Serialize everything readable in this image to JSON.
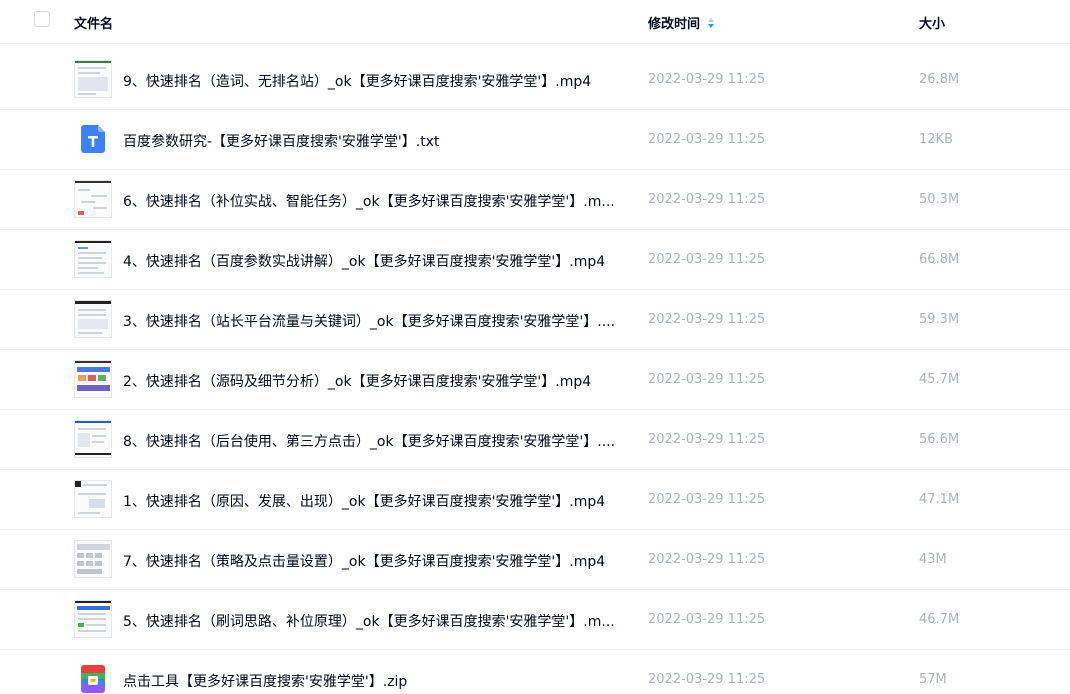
{
  "header": {
    "name_label": "文件名",
    "time_label": "修改时间",
    "size_label": "大小"
  },
  "files": [
    {
      "name": "9、快速排名（造词、无排名站）_ok【更多好课百度搜索'安雅学堂'】.mp4",
      "time": "2022-03-29 11:25",
      "size": "26.8M",
      "type": "video"
    },
    {
      "name": "百度参数研究-【更多好课百度搜索'安雅学堂'】.txt",
      "time": "2022-03-29 11:25",
      "size": "12KB",
      "type": "text"
    },
    {
      "name": "6、快速排名（补位实战、智能任务）_ok【更多好课百度搜索'安雅学堂'】.m...",
      "time": "2022-03-29 11:25",
      "size": "50.3M",
      "type": "video"
    },
    {
      "name": "4、快速排名（百度参数实战讲解）_ok【更多好课百度搜索'安雅学堂'】.mp4",
      "time": "2022-03-29 11:25",
      "size": "66.8M",
      "type": "video"
    },
    {
      "name": "3、快速排名（站长平台流量与关键词）_ok【更多好课百度搜索'安雅学堂'】....",
      "time": "2022-03-29 11:25",
      "size": "59.3M",
      "type": "video"
    },
    {
      "name": "2、快速排名（源码及细节分析）_ok【更多好课百度搜索'安雅学堂'】.mp4",
      "time": "2022-03-29 11:25",
      "size": "45.7M",
      "type": "video"
    },
    {
      "name": "8、快速排名（后台使用、第三方点击）_ok【更多好课百度搜索'安雅学堂'】....",
      "time": "2022-03-29 11:25",
      "size": "56.6M",
      "type": "video"
    },
    {
      "name": "1、快速排名（原因、发展、出现）_ok【更多好课百度搜索'安雅学堂'】.mp4",
      "time": "2022-03-29 11:25",
      "size": "47.1M",
      "type": "video"
    },
    {
      "name": "7、快速排名（策略及点击量设置）_ok【更多好课百度搜索'安雅学堂'】.mp4",
      "time": "2022-03-29 11:25",
      "size": "43M",
      "type": "video"
    },
    {
      "name": "5、快速排名（刷词思路、补位原理）_ok【更多好课百度搜索'安雅学堂'】.m...",
      "time": "2022-03-29 11:25",
      "size": "46.7M",
      "type": "video"
    },
    {
      "name": "点击工具【更多好课百度搜索'安雅学堂'】.zip",
      "time": "2022-03-29 11:25",
      "size": "57M",
      "type": "zip"
    }
  ],
  "icons": {
    "video": "video-thumbnail-icon",
    "text": "text-file-icon",
    "zip": "zip-file-icon"
  },
  "colors": {
    "text_primary": "#03081a",
    "text_secondary": "#afb3bf",
    "accent": "#06a7ff",
    "txt_icon": "#3b82f6"
  }
}
